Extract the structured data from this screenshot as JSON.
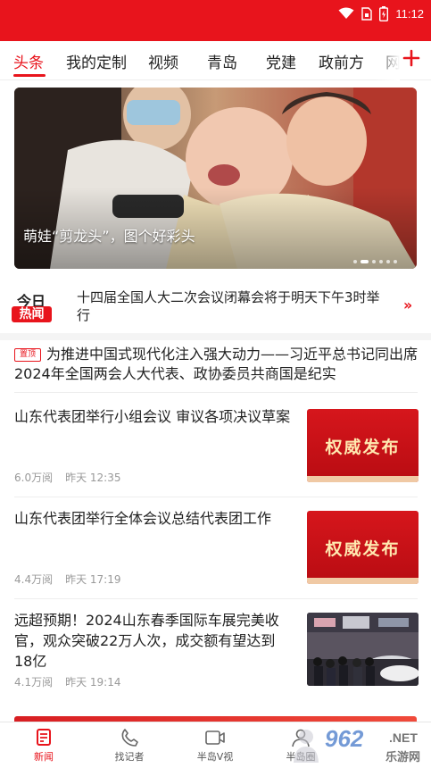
{
  "status_bar": {
    "time": "11:12",
    "accent": "#e8141c"
  },
  "tabs": [
    {
      "label": "头条",
      "active": true
    },
    {
      "label": "我的定制"
    },
    {
      "label": "视频"
    },
    {
      "label": "青岛"
    },
    {
      "label": "党建"
    },
    {
      "label": "政前方"
    },
    {
      "label": "网"
    }
  ],
  "banner": {
    "caption": "萌娃“剪龙头”，图个好彩头",
    "slides": 6,
    "active_slide": 2
  },
  "hot": {
    "badge_top": "今日",
    "badge_bottom": "热闻",
    "text": "十四届全国人大二次会议闭幕会将于明天下午3时举行"
  },
  "top_news": {
    "tag": "置顶",
    "title": "为推进中国式现代化注入强大动力——习近平总书记同出席2024年全国两会人大代表、政协委员共商国是纪实"
  },
  "news": [
    {
      "title": "山东代表团举行小组会议 审议各项决议草案",
      "views": "6.0万阅",
      "time": "昨天 12:35",
      "thumb_text": "权威发布"
    },
    {
      "title": "山东代表团举行全体会议总结代表团工作",
      "views": "4.4万阅",
      "time": "昨天 17:19",
      "thumb_text": "权威发布"
    },
    {
      "title": "远超预期！2024山东春季国际车展完美收官，观众突破22万人次，成交额有望达到18亿",
      "views": "4.1万阅",
      "time": "昨天 19:14"
    }
  ],
  "bottom_nav": [
    {
      "label": "新闻",
      "icon": "news-icon",
      "active": true
    },
    {
      "label": "找记者",
      "icon": "phone-icon"
    },
    {
      "label": "半岛V视",
      "icon": "video-icon"
    },
    {
      "label": "半岛圈",
      "icon": "person-icon"
    }
  ],
  "watermark": {
    "brand": "962",
    "suffix": ".NET",
    "cn": "乐游网"
  }
}
